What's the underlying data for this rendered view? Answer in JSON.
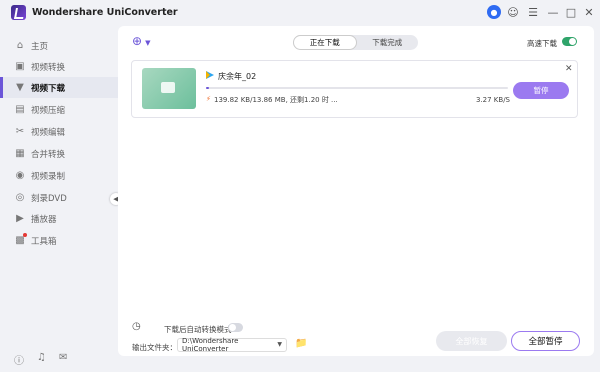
{
  "app": {
    "title": "Wondershare UniConverter"
  },
  "titlebar": {
    "icons": [
      "user-icon",
      "support-icon",
      "menu-icon",
      "minimize-icon",
      "maximize-icon",
      "close-icon"
    ]
  },
  "sidebar": {
    "items": [
      {
        "label": "主页",
        "icon": "home-icon"
      },
      {
        "label": "视频转换",
        "icon": "convert-icon"
      },
      {
        "label": "视频下载",
        "icon": "download-icon",
        "active": true
      },
      {
        "label": "视频压缩",
        "icon": "compress-icon"
      },
      {
        "label": "视频编辑",
        "icon": "edit-icon"
      },
      {
        "label": "合并转换",
        "icon": "merge-icon"
      },
      {
        "label": "视频录制",
        "icon": "record-icon"
      },
      {
        "label": "刻录DVD",
        "icon": "dvd-icon"
      },
      {
        "label": "播放器",
        "icon": "player-icon"
      },
      {
        "label": "工具箱",
        "icon": "toolbox-icon",
        "badge": true
      }
    ],
    "bottom_icons": [
      "help-icon",
      "bell-icon",
      "feedback-icon"
    ]
  },
  "tabs": [
    {
      "label": "正在下载",
      "active": true
    },
    {
      "label": "下载完成",
      "active": false
    }
  ],
  "speed": {
    "label": "高速下载",
    "on": true
  },
  "download": {
    "file_name": "庆余年_02",
    "info": "139.82 KB/13.86 MB, 还剩1.20 时 ...",
    "speed": "3.27 KB/S",
    "progress": 0.01,
    "pause_label": "暂停"
  },
  "footer": {
    "auto_convert_label": "下载后自动转换模式",
    "output_label": "输出文件夹：",
    "output_path": "D:\\Wondershare UniConverter",
    "resume_all_label": "全部恢复",
    "pause_all_label": "全部暂停"
  },
  "colors": {
    "accent": "#6b55d8",
    "button": "#9b7af0",
    "toggle_on": "#2fa46a",
    "bolt": "#ef6c2b"
  }
}
